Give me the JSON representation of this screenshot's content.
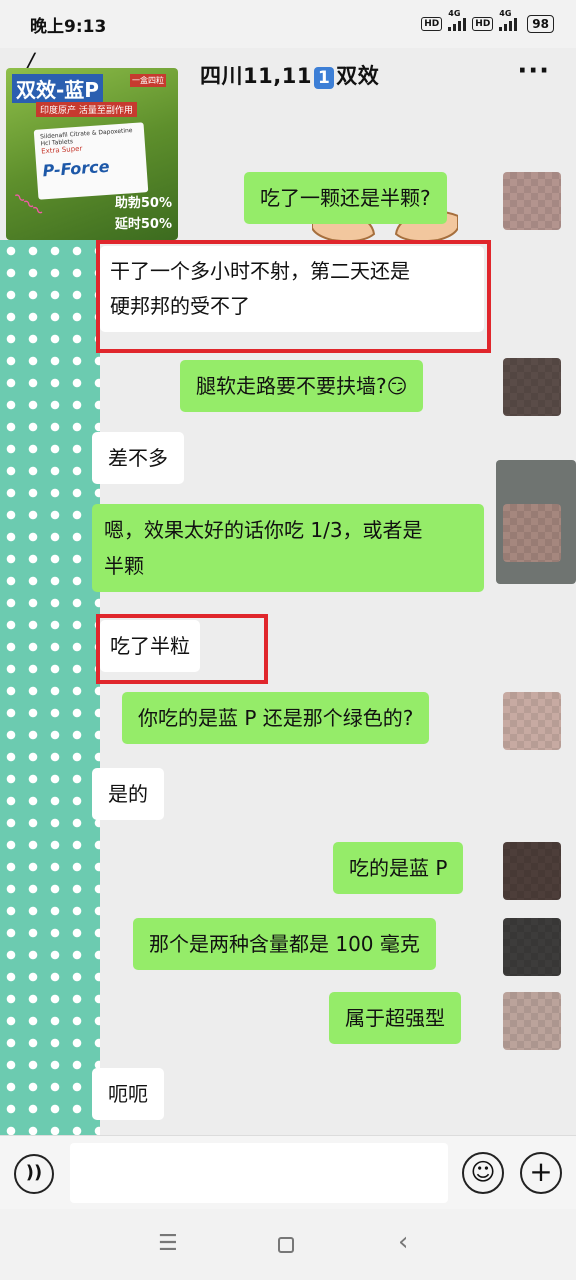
{
  "status_bar": {
    "time": "晚上9:13",
    "hd_badge": "HD",
    "network": "4G",
    "battery": "98"
  },
  "header": {
    "title_prefix": "四川11,11",
    "title_badge": "1",
    "title_suffix": "双效",
    "more_icon": "more-dots-icon"
  },
  "ad_image": {
    "title": "双效-蓝P",
    "subtitle": "一盒四粒",
    "origin": "印度原产 活量至副作用",
    "box_small": "Sildenafil Citrate & Dapoxetine Hcl Tablets",
    "box_series": "Extra Super",
    "box_brand": "P-Force",
    "tag1": "助勃50%",
    "tag2": "延时50%"
  },
  "messages": [
    {
      "side": "out",
      "text": "吃了一颗还是半颗?"
    },
    {
      "side": "in",
      "text_line1": "干了一个多小时不射，第二天还是",
      "text_line2": "硬邦邦的受不了",
      "highlighted": true
    },
    {
      "side": "out",
      "text": "腿软走路要不要扶墙?😏"
    },
    {
      "side": "in",
      "text": "差不多"
    },
    {
      "side": "out",
      "text_line1": "嗯，效果太好的话你吃 1/3，或者是",
      "text_line2": "半颗"
    },
    {
      "side": "in",
      "text": "吃了半粒",
      "highlighted": true
    },
    {
      "side": "out",
      "text": "你吃的是蓝 P 还是那个绿色的?"
    },
    {
      "side": "in",
      "text": "是的"
    },
    {
      "side": "out",
      "text": "吃的是蓝 P"
    },
    {
      "side": "out",
      "text": "那个是两种含量都是 100 毫克"
    },
    {
      "side": "out",
      "text": "属于超强型"
    },
    {
      "side": "in",
      "text": "呃呃"
    }
  ],
  "input_bar": {
    "voice_icon": "voice-input-icon",
    "text_value": "",
    "emoji_icon": "emoji-icon",
    "plus_icon": "plus-icon"
  },
  "colors": {
    "outgoing_bubble": "#95ec69",
    "incoming_bubble": "#ffffff",
    "highlight_box": "#e0262c",
    "background": "#ededed"
  }
}
